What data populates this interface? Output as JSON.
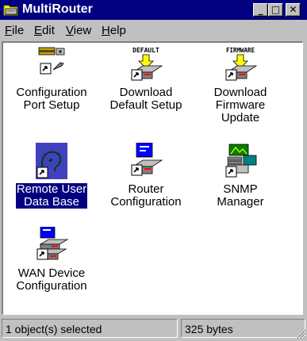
{
  "window": {
    "title": "MultiRouter",
    "buttons": {
      "minimize": "_",
      "maximize": "□",
      "close": "✕"
    }
  },
  "menu": [
    {
      "label": "File",
      "accel": "F",
      "rest": "ile"
    },
    {
      "label": "Edit",
      "accel": "E",
      "rest": "dit"
    },
    {
      "label": "View",
      "accel": "V",
      "rest": "iew"
    },
    {
      "label": "Help",
      "accel": "H",
      "rest": "elp"
    }
  ],
  "items": [
    {
      "line1": "Configuration",
      "line2": "Port Setup",
      "line3": "",
      "icon": "configuration-port-setup-icon",
      "banner": ""
    },
    {
      "line1": "Download",
      "line2": "Default Setup",
      "line3": "",
      "icon": "download-default-setup-icon",
      "banner": "DEFAULT"
    },
    {
      "line1": "Download",
      "line2": "Firmware",
      "line3": "Update",
      "icon": "download-firmware-update-icon",
      "banner": "FIRMWARE"
    },
    {
      "line1": "Remote User",
      "line2": "Data Base",
      "line3": "",
      "icon": "remote-user-data-base-icon",
      "banner": "",
      "selected": true
    },
    {
      "line1": "Router",
      "line2": "Configuration",
      "line3": "",
      "icon": "router-configuration-icon",
      "banner": ""
    },
    {
      "line1": "SNMP",
      "line2": "Manager",
      "line3": "",
      "icon": "snmp-manager-icon",
      "banner": ""
    },
    {
      "line1": "WAN Device",
      "line2": "Configuration",
      "line3": "",
      "icon": "wan-device-configuration-icon",
      "banner": ""
    }
  ],
  "status": {
    "selection": "1 object(s) selected",
    "size": "325 bytes"
  },
  "colors": {
    "titlebar": "#000080",
    "face": "#c0c0c0",
    "selection": "#000080"
  }
}
